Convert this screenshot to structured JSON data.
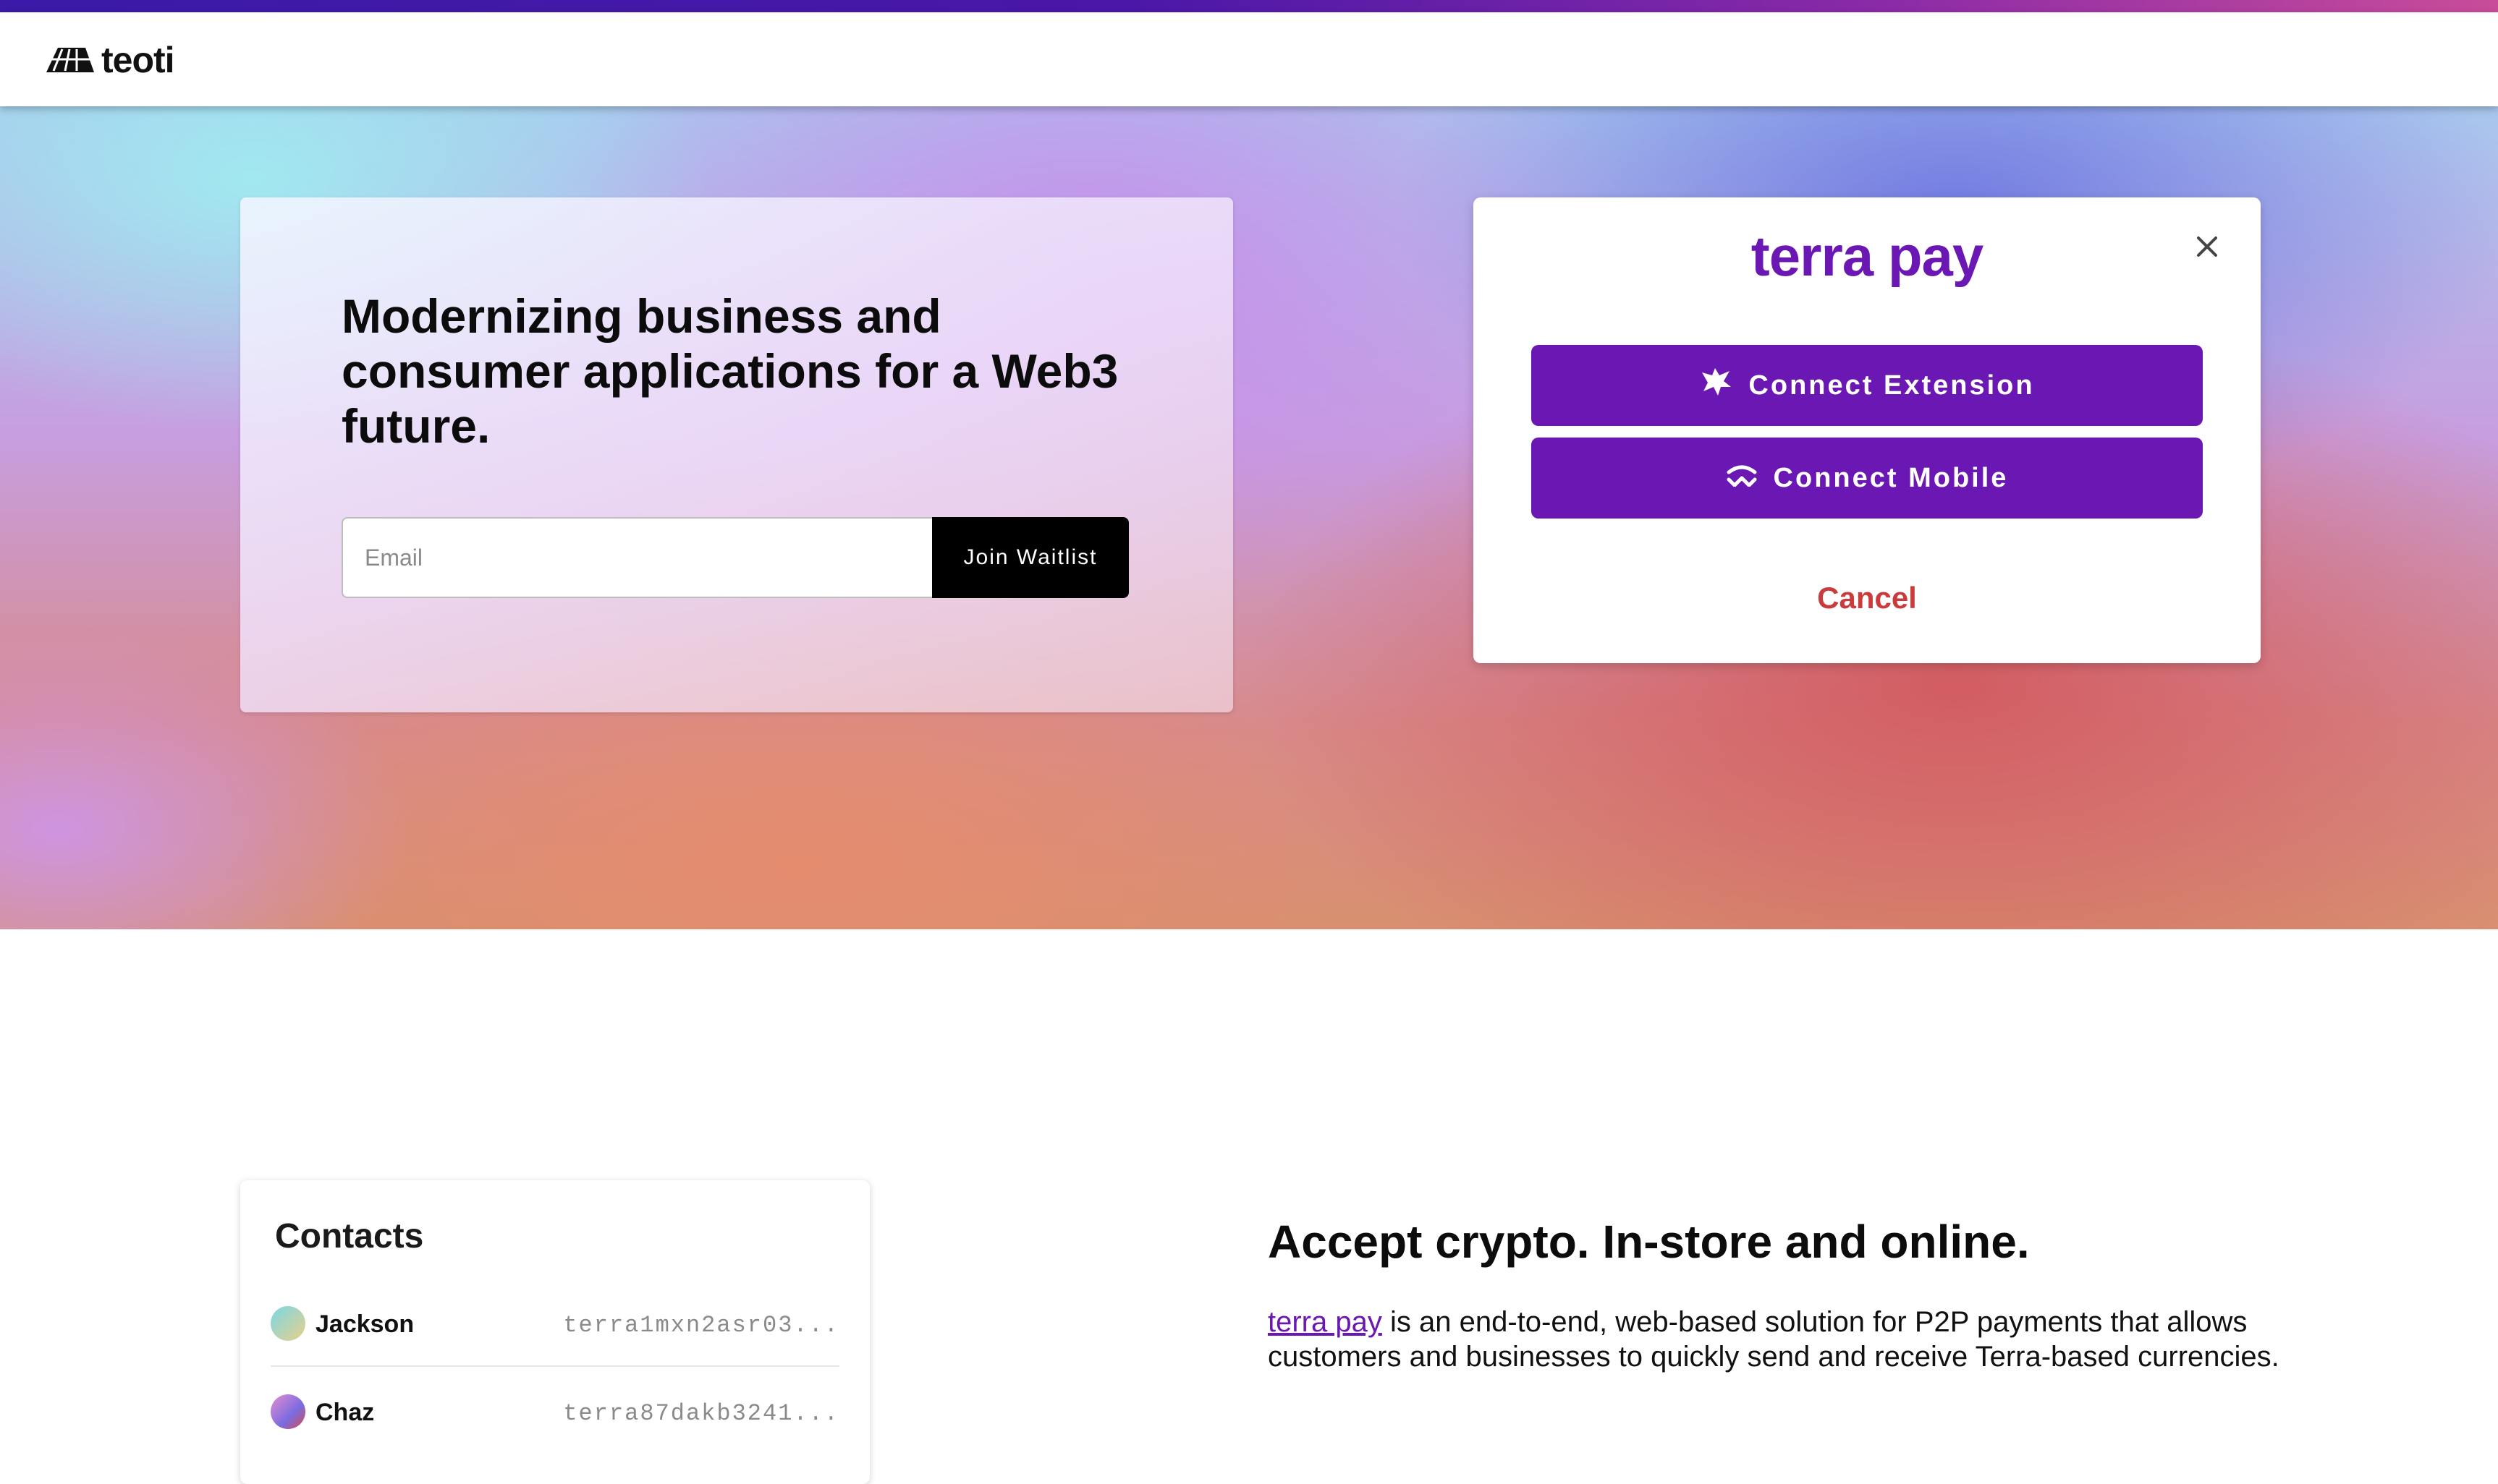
{
  "brand": {
    "logo_text": "teoti"
  },
  "hero": {
    "title": "Modernizing business and consumer applications for a Web3 future.",
    "email_placeholder": "Email",
    "email_value": "",
    "join_label": "Join Waitlist"
  },
  "modal": {
    "brand": "terra pay",
    "connect_extension_label": "Connect Extension",
    "connect_mobile_label": "Connect Mobile",
    "cancel_label": "Cancel"
  },
  "contacts": {
    "title": "Contacts",
    "items": [
      {
        "name": "Jackson",
        "address": "terra1mxn2asr03..."
      },
      {
        "name": "Chaz",
        "address": "terra87dakb3241..."
      }
    ]
  },
  "accept": {
    "title": "Accept crypto. In-store and online.",
    "link_text": "terra pay",
    "body_text": " is an end-to-end, web-based solution for P2P payments that allows customers and businesses to quickly send and receive Terra-based currencies."
  },
  "colors": {
    "accent": "#6a17b3",
    "cancel": "#cc3b3b",
    "join_button": "#000000"
  }
}
